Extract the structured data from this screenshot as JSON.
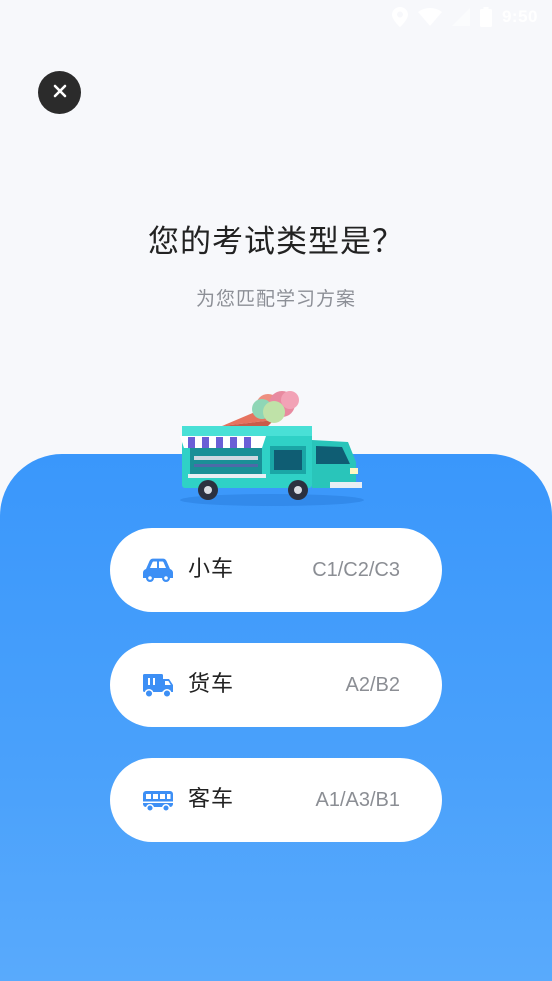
{
  "status_bar": {
    "time": "9:50",
    "icons": [
      "location-icon",
      "wifi-icon",
      "signal-icon",
      "battery-icon"
    ]
  },
  "close_button": {
    "icon": "close-icon",
    "symbol": "×"
  },
  "header": {
    "title": "您的考试类型是？",
    "subtitle": "为您匹配学习方案"
  },
  "illustration": {
    "name": "ice-cream-truck-illustration"
  },
  "options": [
    {
      "icon": "car-icon",
      "label": "小车",
      "code": "C1/C2/C3"
    },
    {
      "icon": "truck-icon",
      "label": "货车",
      "code": "A2/B2"
    },
    {
      "icon": "bus-icon",
      "label": "客车",
      "code": "A1/A3/B1"
    }
  ],
  "colors": {
    "page_background": "#f7f8fb",
    "panel_blue": "#3a97fb",
    "icon_blue": "#3d8ff5",
    "close_button_bg": "#2b2b2b",
    "title_text": "#222222",
    "secondary_text": "#8c8f96"
  }
}
